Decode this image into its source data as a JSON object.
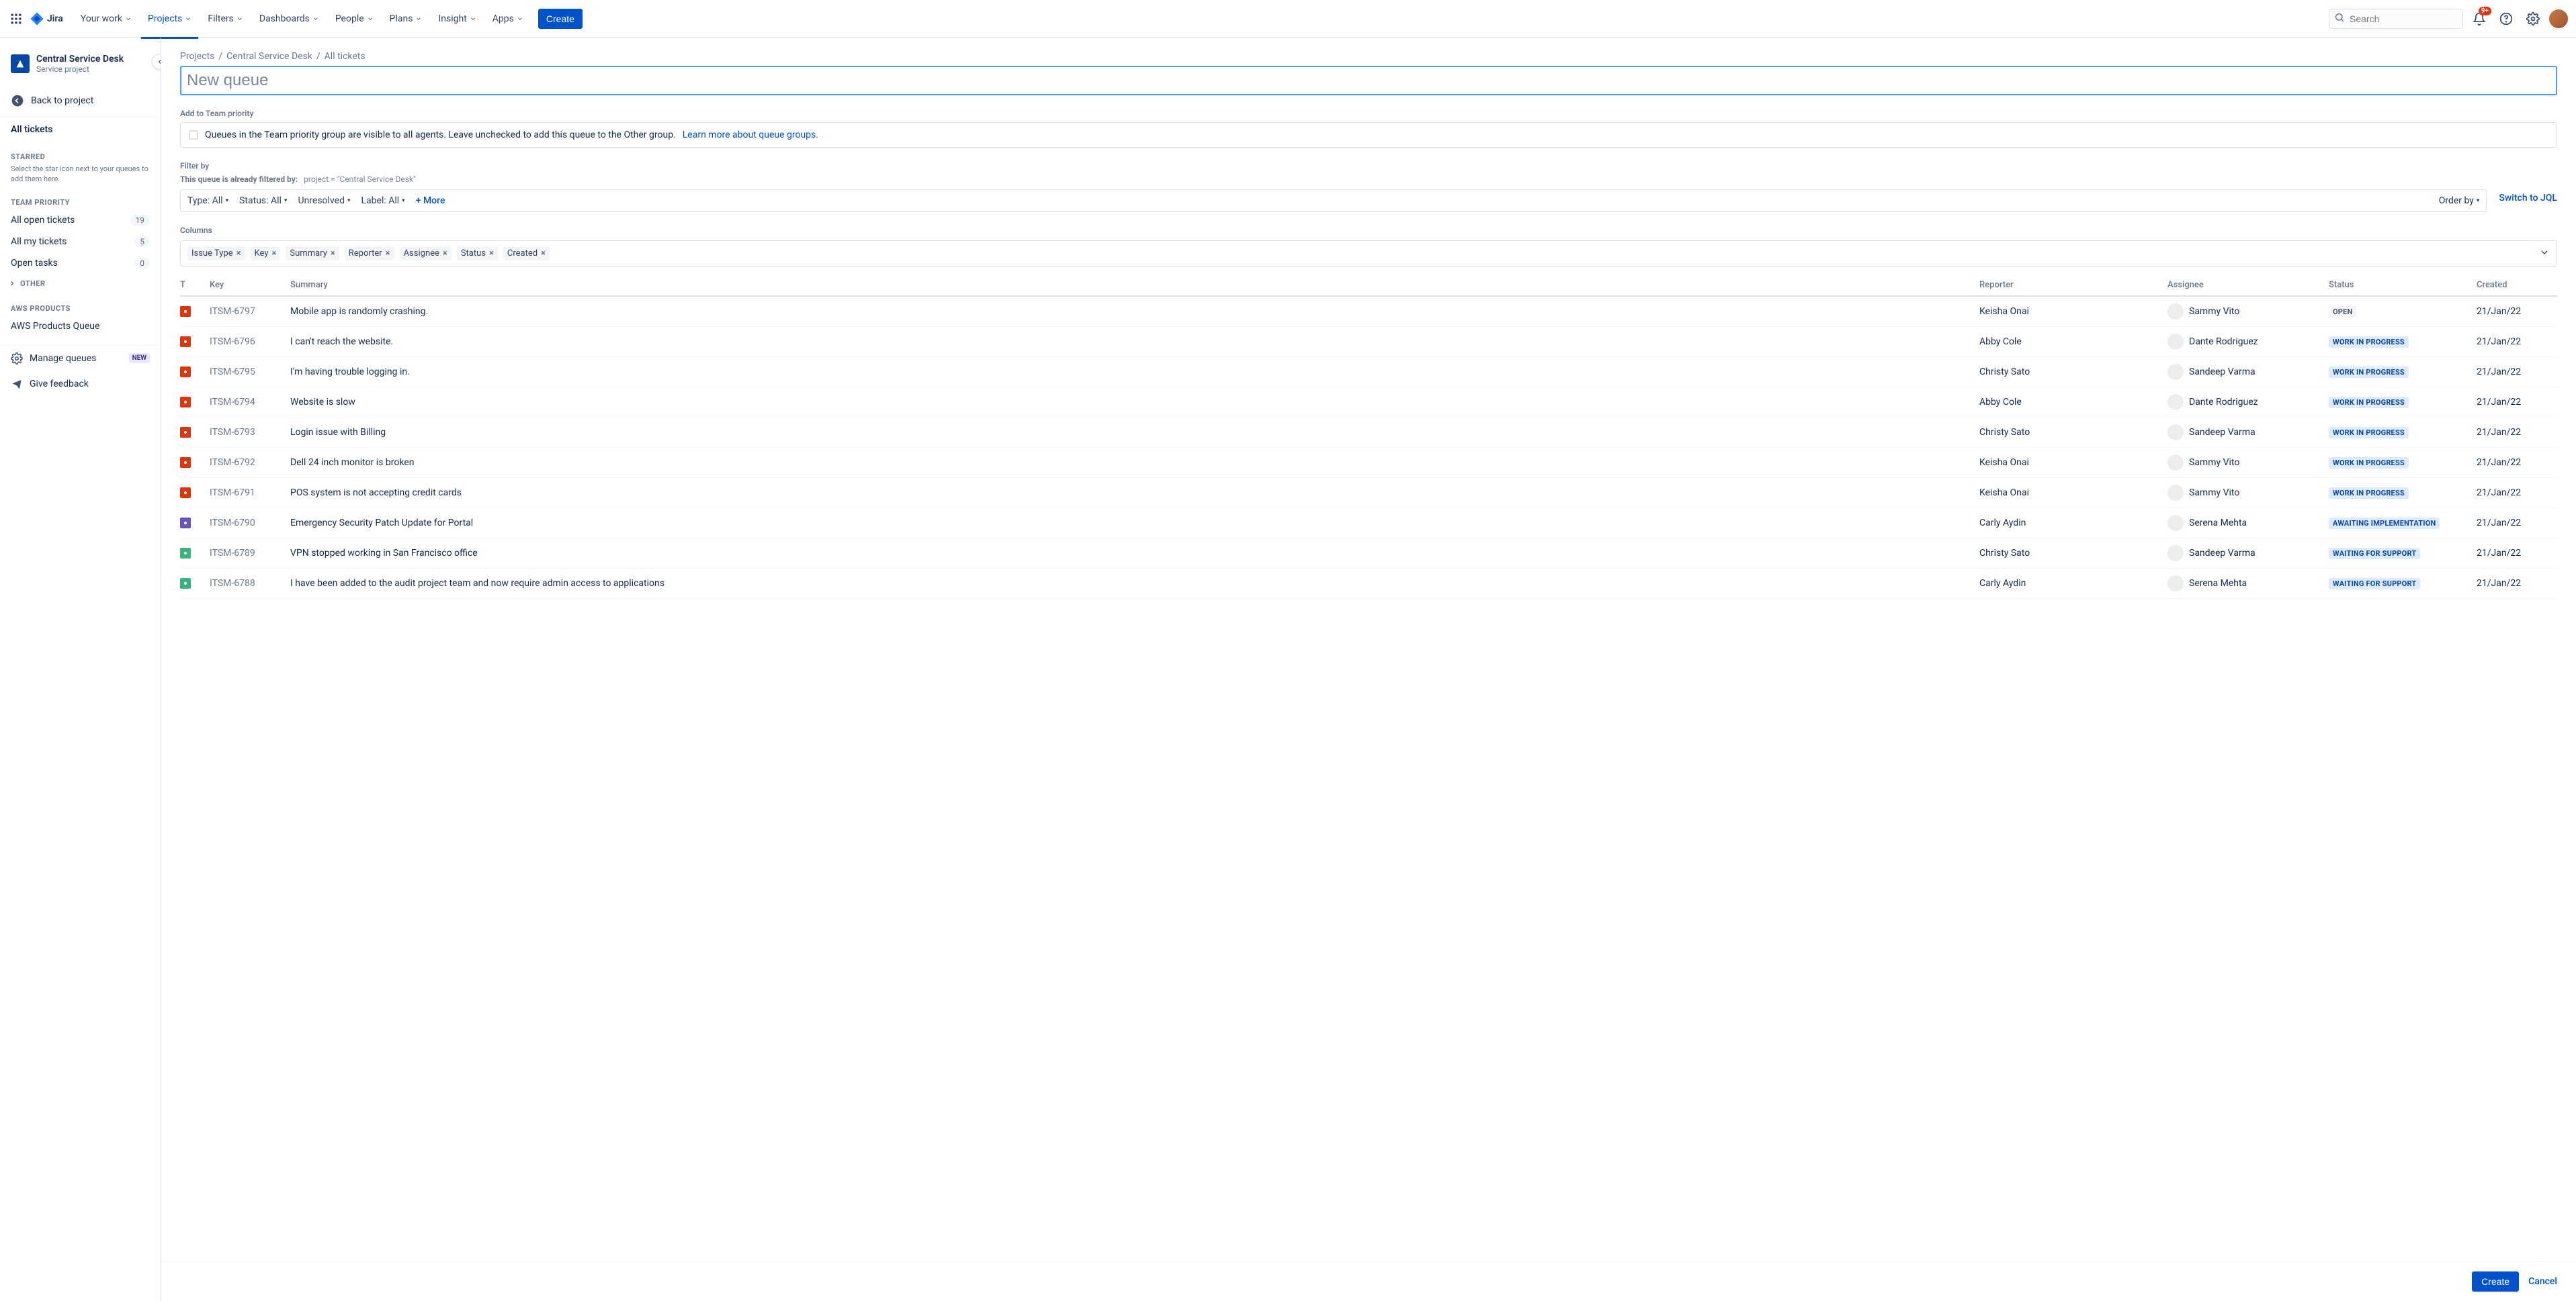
{
  "topnav": {
    "logo": "Jira",
    "items": [
      "Your work",
      "Projects",
      "Filters",
      "Dashboards",
      "People",
      "Plans",
      "Insight",
      "Apps"
    ],
    "active_index": 1,
    "create": "Create",
    "search_placeholder": "Search",
    "notification_badge": "9+"
  },
  "sidebar": {
    "project_title": "Central Service Desk",
    "project_subtitle": "Service project",
    "back": "Back to project",
    "all_tickets": "All tickets",
    "starred_label": "STARRED",
    "starred_help": "Select the star icon next to your queues to add them here.",
    "team_priority_label": "TEAM PRIORITY",
    "team_items": [
      {
        "label": "All open tickets",
        "count": "19"
      },
      {
        "label": "All my tickets",
        "count": "5"
      },
      {
        "label": "Open tasks",
        "count": "0"
      }
    ],
    "other_label": "OTHER",
    "aws_label": "AWS PRODUCTS",
    "aws_queue": "AWS Products Queue",
    "manage": "Manage queues",
    "manage_badge": "NEW",
    "feedback": "Give feedback"
  },
  "breadcrumbs": [
    "Projects",
    "Central Service Desk",
    "All tickets"
  ],
  "queue_name_placeholder": "New queue",
  "team_priority": {
    "label": "Add to Team priority",
    "text": "Queues in the Team priority group are visible to all agents. Leave unchecked to add this queue to the Other group.",
    "learn": "Learn more about queue groups."
  },
  "filter": {
    "label": "Filter by",
    "note_prefix": "This queue is already filtered by:",
    "note_value": "project = \"Central Service Desk\"",
    "type": "Type: All",
    "status": "Status: All",
    "unresolved": "Unresolved",
    "label_filter": "Label: All",
    "more": "+ More",
    "order_by": "Order by",
    "jql": "Switch to JQL"
  },
  "columns": {
    "label": "Columns",
    "tags": [
      "Issue Type",
      "Key",
      "Summary",
      "Reporter",
      "Assignee",
      "Status",
      "Created"
    ]
  },
  "table": {
    "headers": {
      "t": "T",
      "key": "Key",
      "summary": "Summary",
      "reporter": "Reporter",
      "assignee": "Assignee",
      "status": "Status",
      "created": "Created"
    },
    "rows": [
      {
        "type": "red",
        "key": "ITSM-6797",
        "summary": "Mobile app is randomly crashing.",
        "reporter": "Keisha Onai",
        "assignee": "Sammy Vito",
        "status": "OPEN",
        "status_style": "open",
        "created": "21/Jan/22"
      },
      {
        "type": "red",
        "key": "ITSM-6796",
        "summary": "I can't reach the website.",
        "reporter": "Abby Cole",
        "assignee": "Dante Rodriguez",
        "status": "WORK IN PROGRESS",
        "status_style": "blue",
        "created": "21/Jan/22"
      },
      {
        "type": "red",
        "key": "ITSM-6795",
        "summary": "I'm having trouble logging in.",
        "reporter": "Christy Sato",
        "assignee": "Sandeep Varma",
        "status": "WORK IN PROGRESS",
        "status_style": "blue",
        "created": "21/Jan/22"
      },
      {
        "type": "red",
        "key": "ITSM-6794",
        "summary": "Website is slow",
        "reporter": "Abby Cole",
        "assignee": "Dante Rodriguez",
        "status": "WORK IN PROGRESS",
        "status_style": "blue",
        "created": "21/Jan/22"
      },
      {
        "type": "red",
        "key": "ITSM-6793",
        "summary": "Login issue with Billing",
        "reporter": "Christy Sato",
        "assignee": "Sandeep Varma",
        "status": "WORK IN PROGRESS",
        "status_style": "blue",
        "created": "21/Jan/22"
      },
      {
        "type": "red",
        "key": "ITSM-6792",
        "summary": "Dell 24 inch monitor is broken",
        "reporter": "Keisha Onai",
        "assignee": "Sammy Vito",
        "status": "WORK IN PROGRESS",
        "status_style": "blue",
        "created": "21/Jan/22"
      },
      {
        "type": "red",
        "key": "ITSM-6791",
        "summary": "POS system is not accepting credit cards",
        "reporter": "Keisha Onai",
        "assignee": "Sammy Vito",
        "status": "WORK IN PROGRESS",
        "status_style": "blue",
        "created": "21/Jan/22"
      },
      {
        "type": "purple",
        "key": "ITSM-6790",
        "summary": "Emergency Security Patch Update for Portal",
        "reporter": "Carly Aydin",
        "assignee": "Serena Mehta",
        "status": "AWAITING IMPLEMENTATION",
        "status_style": "blue",
        "created": "21/Jan/22"
      },
      {
        "type": "green",
        "key": "ITSM-6789",
        "summary": "VPN stopped working in San Francisco office",
        "reporter": "Christy Sato",
        "assignee": "Sandeep Varma",
        "status": "WAITING FOR SUPPORT",
        "status_style": "blue",
        "created": "21/Jan/22"
      },
      {
        "type": "green",
        "key": "ITSM-6788",
        "summary": "I have been added to the audit project team and now require admin access to applications",
        "reporter": "Carly Aydin",
        "assignee": "Serena Mehta",
        "status": "WAITING FOR SUPPORT",
        "status_style": "blue",
        "created": "21/Jan/22"
      }
    ]
  },
  "footer": {
    "create": "Create",
    "cancel": "Cancel"
  }
}
